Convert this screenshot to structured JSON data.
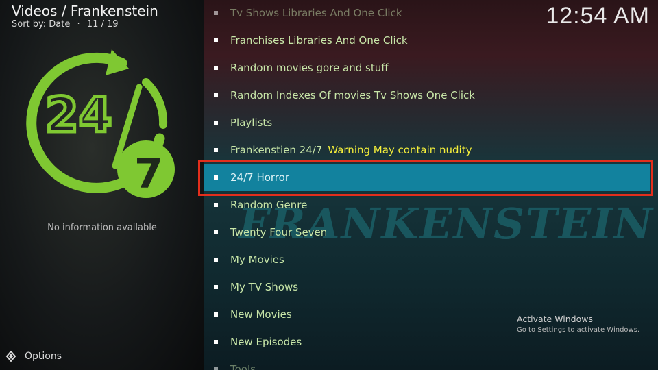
{
  "header": {
    "title": "Videos / Frankenstein",
    "sort_label": "Sort by: Date",
    "separator": "·",
    "position": "11 / 19"
  },
  "clock": "12:54 AM",
  "info": {
    "no_info": "No information available"
  },
  "options_label": "Options",
  "logo": {
    "text_top": "24",
    "text_bottom": "7"
  },
  "watermark": "FRANKENSTEIN",
  "list": [
    {
      "label": "Tv Shows Libraries And One Click"
    },
    {
      "label": "Franchises Libraries And One Click"
    },
    {
      "label": "Random movies gore and stuff"
    },
    {
      "label": "Random Indexes Of movies Tv Shows One Click"
    },
    {
      "label": "Playlists"
    },
    {
      "label": "Frankenstien 24/7",
      "warning": "Warning May contain nudity"
    },
    {
      "label": "24/7 Horror"
    },
    {
      "label": "Random Genre"
    },
    {
      "label": "Twenty Four Seven"
    },
    {
      "label": "My Movies"
    },
    {
      "label": "My TV Shows"
    },
    {
      "label": "New Movies"
    },
    {
      "label": "New Episodes"
    },
    {
      "label": "Tools"
    }
  ],
  "selected_index": 6,
  "activate": {
    "line1": "Activate Windows",
    "line2": "Go to Settings to activate Windows."
  },
  "colors": {
    "accent": "#12829e",
    "highlight_border": "#e32e1c",
    "item_text": "#c8e6a8",
    "warning_text": "#f5ef3a",
    "logo_green": "#7fc832"
  }
}
